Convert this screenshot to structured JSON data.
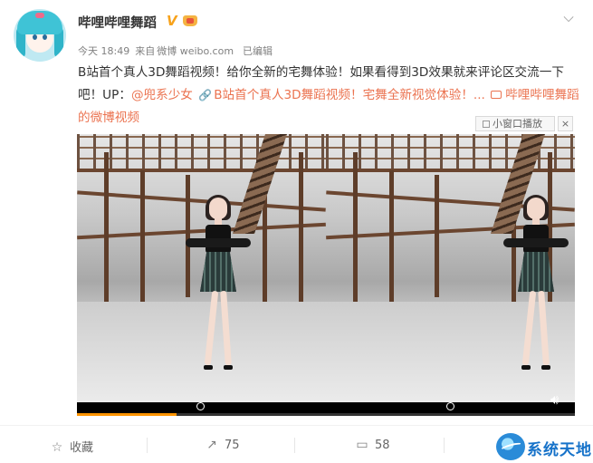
{
  "post": {
    "author": "哔哩哔哩舞蹈",
    "verified_mark": "V",
    "meta": {
      "time": "今天 18:49",
      "source_prefix": "来自",
      "source_app": "微博 weibo.com",
      "edited": "已编辑"
    },
    "text_part1": "B站首个真人3D舞蹈视频！给你全新的宅舞体验！如果看得到3D效果就来评论区交流一下吧！UP：",
    "mention": "@兜系少女",
    "link_text": "B站首个真人3D舞蹈视频！宅舞全新视觉体验！...",
    "video_link": "哔哩哔哩舞蹈的微博视频",
    "mini_window_label": "小窗口播放",
    "close_label": "×"
  },
  "player": {
    "progress": 0.2,
    "colors": {
      "progress_fill": "#ff9400",
      "background": "#000000"
    }
  },
  "actions": {
    "favorite_label": "收藏",
    "share_count": "75",
    "comment_count": "58"
  },
  "watermark": {
    "text": "系统天地"
  },
  "colors": {
    "link": "#eb7350",
    "verified": "#f7a21b",
    "watermark": "#1672c9"
  }
}
